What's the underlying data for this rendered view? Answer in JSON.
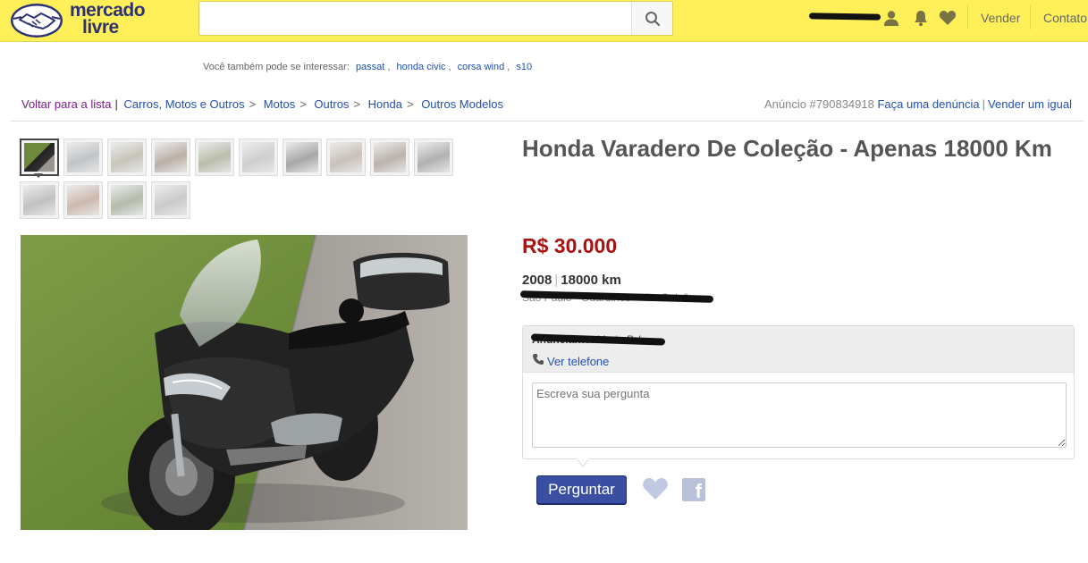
{
  "header": {
    "logo_line1": "mercado",
    "logo_line2": "livre",
    "search_placeholder": "",
    "nav_vender": "Vender",
    "nav_contato": "Contato"
  },
  "interest": {
    "label": "Você também pode se interessar:",
    "items": [
      "passat",
      "honda civic",
      "corsa wind",
      "s10"
    ]
  },
  "breadcrumb": {
    "back": "Voltar para a lista",
    "items": [
      "Carros, Motos e Outros",
      "Motos",
      "Outros",
      "Honda",
      "Outros Modelos"
    ]
  },
  "ad_meta": {
    "ad_id": "Anúncio #790834918",
    "report": "Faça uma denúncia",
    "sell_same": "Vender um igual"
  },
  "listing": {
    "title": "Honda Varadero De Coleção - Apenas 18000 Km",
    "price": "R$ 30.000",
    "year": "2008",
    "km": "18000 km",
    "location": "São Paulo - Guarulhos - Vila Galvão",
    "thumbnail_count": 14
  },
  "contact": {
    "seller_label": "Anunciante:",
    "seller_name": "Maria P. L.",
    "phone_link": "Ver telefone",
    "question_placeholder": "Escreva sua pergunta",
    "ask_button": "Perguntar"
  },
  "colors": {
    "header_bg": "#fff059",
    "brand_navy": "#2d3277",
    "price_red": "#a11",
    "link_blue": "#2450b2",
    "button_blue": "#3a4fa2"
  },
  "icons": [
    "search-icon",
    "user-icon",
    "bell-icon",
    "heart-icon",
    "phone-icon",
    "facebook-icon"
  ]
}
